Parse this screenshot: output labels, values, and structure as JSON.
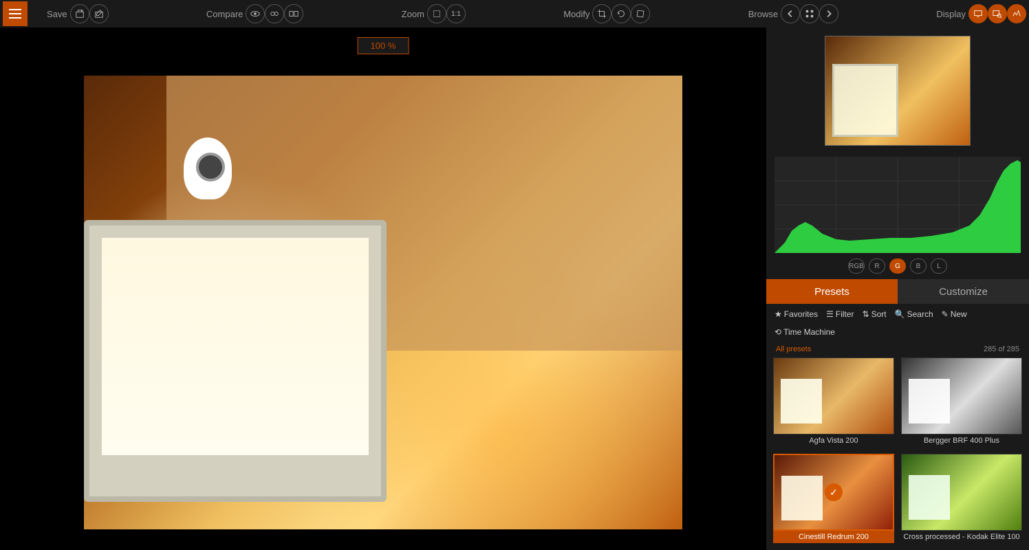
{
  "toolbar": {
    "save_label": "Save",
    "compare_label": "Compare",
    "zoom_label": "Zoom",
    "one_to_one": "1:1",
    "modify_label": "Modify",
    "browse_label": "Browse",
    "display_label": "Display"
  },
  "canvas": {
    "zoom_badge": "100 %"
  },
  "histogram": {
    "channels": {
      "rgb": "RGB",
      "r": "R",
      "g": "G",
      "b": "B",
      "l": "L"
    },
    "active_channel": "G"
  },
  "tabs": {
    "presets": "Presets",
    "customize": "Customize"
  },
  "filters": {
    "favorites": "Favorites",
    "filter": "Filter",
    "sort": "Sort",
    "search": "Search",
    "new": "New",
    "time_machine": "Time Machine"
  },
  "preset_header": {
    "all": "All presets",
    "count": "285 of 285"
  },
  "presets": [
    {
      "name": "Agfa Vista 200",
      "style": "pi-color",
      "selected": false
    },
    {
      "name": "Bergger BRF 400 Plus",
      "style": "pi-bw",
      "selected": false
    },
    {
      "name": "Cinestill Redrum 200",
      "style": "pi-red",
      "selected": true
    },
    {
      "name": "Cross processed - Kodak Elite 100",
      "style": "pi-cross",
      "selected": false
    }
  ]
}
